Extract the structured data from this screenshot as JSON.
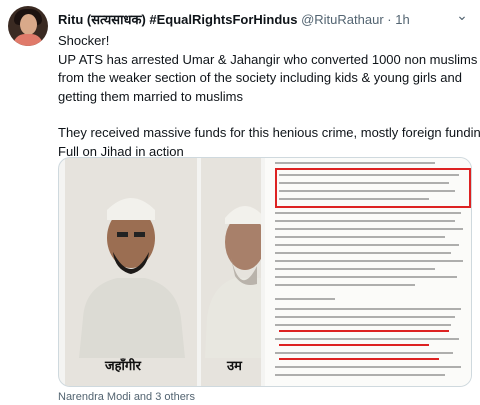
{
  "tweet": {
    "author_name": "Ritu (सत्यसाधक) #EqualRightsForHindus",
    "handle": "@RituRathaur",
    "separator": "·",
    "time": "1h",
    "lines": [
      "Shocker!",
      "UP ATS has arrested Umar & Jahangir who converted 1000 non muslims",
      "from the weaker section of the society  including kids & young girls and",
      "getting them married to muslims",
      "",
      "They received massive funds for this henious crime, mostly foreign funding",
      "Full on Jihad in action"
    ],
    "more_icon": "chevron-down-icon",
    "media": {
      "photo_1_caption": "जहाँगीर",
      "photo_2_caption": "उम"
    },
    "liked_by": "Narendra Modi and 3 others"
  },
  "colors": {
    "text": "#0f1419",
    "muted": "#536471",
    "border": "#cfd9de",
    "highlight": "#dd2222"
  }
}
